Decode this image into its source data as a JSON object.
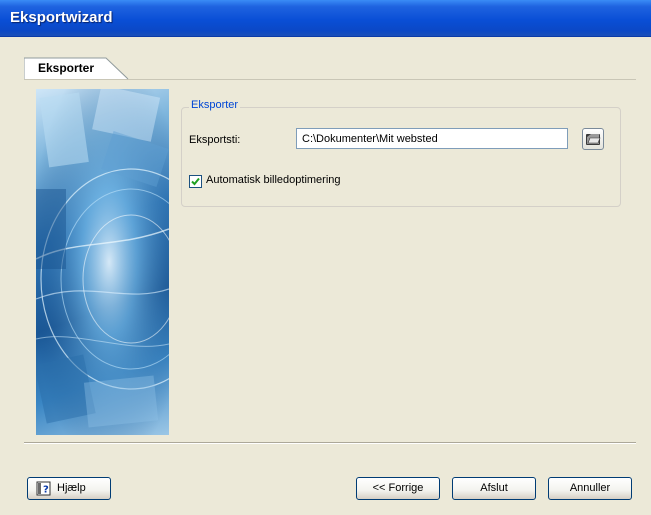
{
  "window": {
    "title": "Eksportwizard"
  },
  "tabs": [
    {
      "label": "Eksporter",
      "active": true
    }
  ],
  "group": {
    "label": "Eksporter",
    "path_label": "Eksportsti:",
    "path_value": "C:\\Dokumenter\\Mit websted",
    "browse_icon": "folder-open-icon",
    "checkbox_label": "Automatisk billedoptimering",
    "checkbox_checked": true
  },
  "buttons": {
    "help": "Hjælp",
    "help_icon": "help-book-icon",
    "back": "<< Forrige",
    "finish": "Afslut",
    "cancel": "Annuller"
  },
  "colors": {
    "titlebar": "#0a4fd6",
    "accent": "#0046d5",
    "face": "#ece9d8"
  }
}
